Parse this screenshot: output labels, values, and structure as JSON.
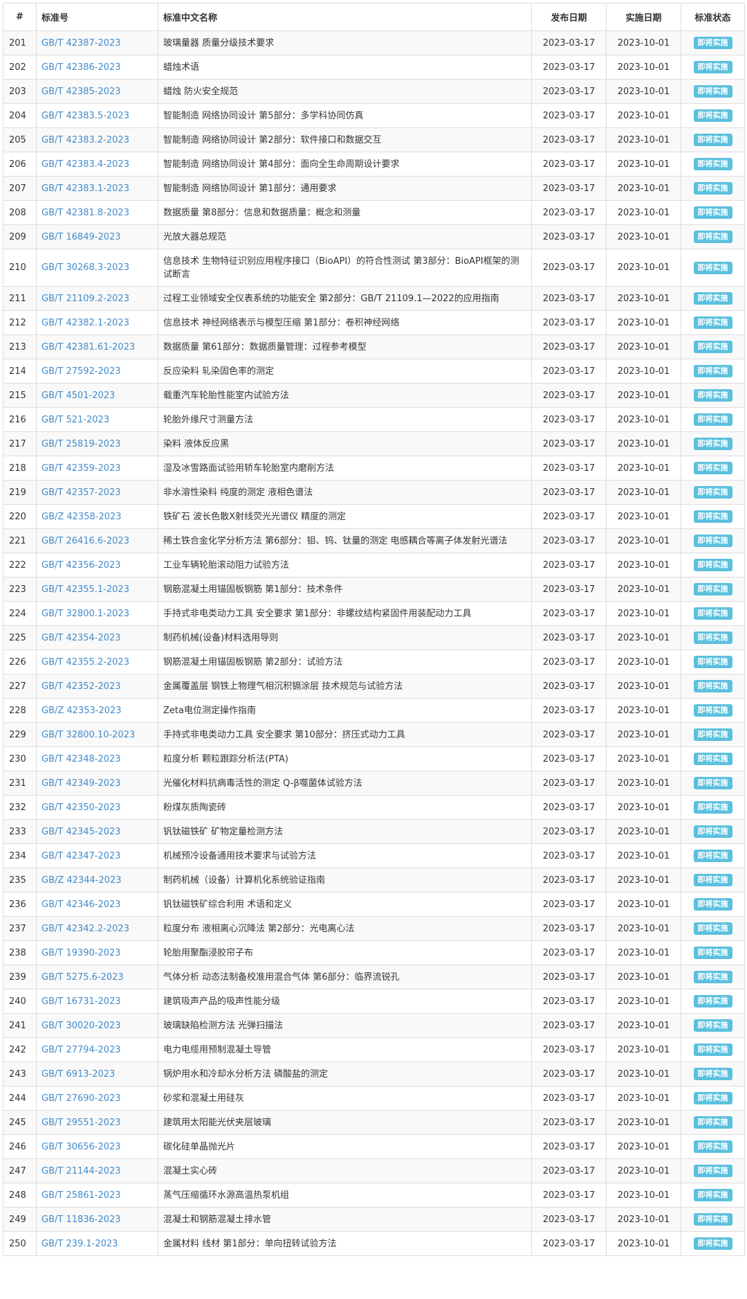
{
  "colors": {
    "link": "#428bca",
    "badge_bg": "#5bc0de",
    "stripe": "#f9f9f9",
    "border": "#dddddd"
  },
  "headers": {
    "num": "#",
    "code": "标准号",
    "name": "标准中文名称",
    "publish": "发布日期",
    "implement": "实施日期",
    "status": "标准状态"
  },
  "rows": [
    {
      "num": "201",
      "code": "GB/T 42387-2023",
      "name": "玻璃量器 质量分级技术要求",
      "publish": "2023-03-17",
      "implement": "2023-10-01",
      "status": "即将实施"
    },
    {
      "num": "202",
      "code": "GB/T 42386-2023",
      "name": "蜡烛术语",
      "publish": "2023-03-17",
      "implement": "2023-10-01",
      "status": "即将实施"
    },
    {
      "num": "203",
      "code": "GB/T 42385-2023",
      "name": "蜡烛 防火安全规范",
      "publish": "2023-03-17",
      "implement": "2023-10-01",
      "status": "即将实施"
    },
    {
      "num": "204",
      "code": "GB/T 42383.5-2023",
      "name": "智能制造 网络协同设计 第5部分：多学科协同仿真",
      "publish": "2023-03-17",
      "implement": "2023-10-01",
      "status": "即将实施"
    },
    {
      "num": "205",
      "code": "GB/T 42383.2-2023",
      "name": "智能制造 网络协同设计 第2部分：软件接口和数据交互",
      "publish": "2023-03-17",
      "implement": "2023-10-01",
      "status": "即将实施"
    },
    {
      "num": "206",
      "code": "GB/T 42383.4-2023",
      "name": "智能制造 网络协同设计 第4部分：面向全生命周期设计要求",
      "publish": "2023-03-17",
      "implement": "2023-10-01",
      "status": "即将实施"
    },
    {
      "num": "207",
      "code": "GB/T 42383.1-2023",
      "name": "智能制造 网络协同设计 第1部分：通用要求",
      "publish": "2023-03-17",
      "implement": "2023-10-01",
      "status": "即将实施"
    },
    {
      "num": "208",
      "code": "GB/T 42381.8-2023",
      "name": "数据质量 第8部分：信息和数据质量：概念和测量",
      "publish": "2023-03-17",
      "implement": "2023-10-01",
      "status": "即将实施"
    },
    {
      "num": "209",
      "code": "GB/T 16849-2023",
      "name": "光放大器总规范",
      "publish": "2023-03-17",
      "implement": "2023-10-01",
      "status": "即将实施"
    },
    {
      "num": "210",
      "code": "GB/T 30268.3-2023",
      "name": "信息技术 生物特征识别应用程序接口（BioAPI）的符合性测试 第3部分：BioAPI框架的测试断言",
      "publish": "2023-03-17",
      "implement": "2023-10-01",
      "status": "即将实施",
      "tall": true
    },
    {
      "num": "211",
      "code": "GB/T 21109.2-2023",
      "name": "过程工业领域安全仪表系统的功能安全 第2部分：GB/T 21109.1—2022的应用指南",
      "publish": "2023-03-17",
      "implement": "2023-10-01",
      "status": "即将实施"
    },
    {
      "num": "212",
      "code": "GB/T 42382.1-2023",
      "name": "信息技术 神经网络表示与模型压缩 第1部分：卷积神经网络",
      "publish": "2023-03-17",
      "implement": "2023-10-01",
      "status": "即将实施"
    },
    {
      "num": "213",
      "code": "GB/T 42381.61-2023",
      "name": "数据质量 第61部分：数据质量管理：过程参考模型",
      "publish": "2023-03-17",
      "implement": "2023-10-01",
      "status": "即将实施"
    },
    {
      "num": "214",
      "code": "GB/T 27592-2023",
      "name": "反应染料 轧染固色率的测定",
      "publish": "2023-03-17",
      "implement": "2023-10-01",
      "status": "即将实施"
    },
    {
      "num": "215",
      "code": "GB/T 4501-2023",
      "name": "载重汽车轮胎性能室内试验方法",
      "publish": "2023-03-17",
      "implement": "2023-10-01",
      "status": "即将实施"
    },
    {
      "num": "216",
      "code": "GB/T 521-2023",
      "name": "轮胎外缘尺寸测量方法",
      "publish": "2023-03-17",
      "implement": "2023-10-01",
      "status": "即将实施"
    },
    {
      "num": "217",
      "code": "GB/T 25819-2023",
      "name": "染料 液体反应黑",
      "publish": "2023-03-17",
      "implement": "2023-10-01",
      "status": "即将实施"
    },
    {
      "num": "218",
      "code": "GB/T 42359-2023",
      "name": "湿及冰雪路面试验用轿车轮胎室内磨削方法",
      "publish": "2023-03-17",
      "implement": "2023-10-01",
      "status": "即将实施"
    },
    {
      "num": "219",
      "code": "GB/T 42357-2023",
      "name": "非水溶性染料 纯度的测定 液相色谱法",
      "publish": "2023-03-17",
      "implement": "2023-10-01",
      "status": "即将实施"
    },
    {
      "num": "220",
      "code": "GB/Z 42358-2023",
      "name": "铁矿石 波长色散X射线荧光光谱仪 精度的测定",
      "publish": "2023-03-17",
      "implement": "2023-10-01",
      "status": "即将实施"
    },
    {
      "num": "221",
      "code": "GB/T 26416.6-2023",
      "name": "稀土铁合金化学分析方法 第6部分：钼、钨、钛量的测定 电感耦合等离子体发射光谱法",
      "publish": "2023-03-17",
      "implement": "2023-10-01",
      "status": "即将实施"
    },
    {
      "num": "222",
      "code": "GB/T 42356-2023",
      "name": "工业车辆轮胎滚动阻力试验方法",
      "publish": "2023-03-17",
      "implement": "2023-10-01",
      "status": "即将实施"
    },
    {
      "num": "223",
      "code": "GB/T 42355.1-2023",
      "name": "钢筋混凝土用锚固板钢筋 第1部分：技术条件",
      "publish": "2023-03-17",
      "implement": "2023-10-01",
      "status": "即将实施"
    },
    {
      "num": "224",
      "code": "GB/T 32800.1-2023",
      "name": "手持式非电类动力工具 安全要求 第1部分：非螺纹结构紧固件用装配动力工具",
      "publish": "2023-03-17",
      "implement": "2023-10-01",
      "status": "即将实施"
    },
    {
      "num": "225",
      "code": "GB/T 42354-2023",
      "name": "制药机械(设备)材料选用导则",
      "publish": "2023-03-17",
      "implement": "2023-10-01",
      "status": "即将实施"
    },
    {
      "num": "226",
      "code": "GB/T 42355.2-2023",
      "name": "钢筋混凝土用锚固板钢筋 第2部分：试验方法",
      "publish": "2023-03-17",
      "implement": "2023-10-01",
      "status": "即将实施"
    },
    {
      "num": "227",
      "code": "GB/T 42352-2023",
      "name": "金属覆盖层 钢铁上物理气相沉积镉涂层 技术规范与试验方法",
      "publish": "2023-03-17",
      "implement": "2023-10-01",
      "status": "即将实施"
    },
    {
      "num": "228",
      "code": "GB/Z 42353-2023",
      "name": "Zeta电位测定操作指南",
      "publish": "2023-03-17",
      "implement": "2023-10-01",
      "status": "即将实施"
    },
    {
      "num": "229",
      "code": "GB/T 32800.10-2023",
      "name": "手持式非电类动力工具 安全要求 第10部分：挤压式动力工具",
      "publish": "2023-03-17",
      "implement": "2023-10-01",
      "status": "即将实施"
    },
    {
      "num": "230",
      "code": "GB/T 42348-2023",
      "name": "粒度分析 颗粒跟踪分析法(PTA)",
      "publish": "2023-03-17",
      "implement": "2023-10-01",
      "status": "即将实施"
    },
    {
      "num": "231",
      "code": "GB/T 42349-2023",
      "name": "光催化材料抗病毒活性的测定 Q-β噬菌体试验方法",
      "publish": "2023-03-17",
      "implement": "2023-10-01",
      "status": "即将实施"
    },
    {
      "num": "232",
      "code": "GB/T 42350-2023",
      "name": "粉煤灰质陶瓷砖",
      "publish": "2023-03-17",
      "implement": "2023-10-01",
      "status": "即将实施"
    },
    {
      "num": "233",
      "code": "GB/T 42345-2023",
      "name": "钒钛磁铁矿 矿物定量检测方法",
      "publish": "2023-03-17",
      "implement": "2023-10-01",
      "status": "即将实施"
    },
    {
      "num": "234",
      "code": "GB/T 42347-2023",
      "name": "机械预冷设备通用技术要求与试验方法",
      "publish": "2023-03-17",
      "implement": "2023-10-01",
      "status": "即将实施"
    },
    {
      "num": "235",
      "code": "GB/Z 42344-2023",
      "name": "制药机械（设备）计算机化系统验证指南",
      "publish": "2023-03-17",
      "implement": "2023-10-01",
      "status": "即将实施"
    },
    {
      "num": "236",
      "code": "GB/T 42346-2023",
      "name": "钒钛磁铁矿综合利用 术语和定义",
      "publish": "2023-03-17",
      "implement": "2023-10-01",
      "status": "即将实施"
    },
    {
      "num": "237",
      "code": "GB/T 42342.2-2023",
      "name": "粒度分布 液相离心沉降法 第2部分：光电离心法",
      "publish": "2023-03-17",
      "implement": "2023-10-01",
      "status": "即将实施"
    },
    {
      "num": "238",
      "code": "GB/T 19390-2023",
      "name": "轮胎用聚酯浸胶帘子布",
      "publish": "2023-03-17",
      "implement": "2023-10-01",
      "status": "即将实施"
    },
    {
      "num": "239",
      "code": "GB/T 5275.6-2023",
      "name": "气体分析 动态法制备校准用混合气体 第6部分：临界流锐孔",
      "publish": "2023-03-17",
      "implement": "2023-10-01",
      "status": "即将实施"
    },
    {
      "num": "240",
      "code": "GB/T 16731-2023",
      "name": "建筑吸声产品的吸声性能分级",
      "publish": "2023-03-17",
      "implement": "2023-10-01",
      "status": "即将实施"
    },
    {
      "num": "241",
      "code": "GB/T 30020-2023",
      "name": "玻璃缺陷检测方法 光弹扫描法",
      "publish": "2023-03-17",
      "implement": "2023-10-01",
      "status": "即将实施"
    },
    {
      "num": "242",
      "code": "GB/T 27794-2023",
      "name": "电力电缆用预制混凝土导管",
      "publish": "2023-03-17",
      "implement": "2023-10-01",
      "status": "即将实施"
    },
    {
      "num": "243",
      "code": "GB/T 6913-2023",
      "name": "锅炉用水和冷却水分析方法 磷酸盐的测定",
      "publish": "2023-03-17",
      "implement": "2023-10-01",
      "status": "即将实施"
    },
    {
      "num": "244",
      "code": "GB/T 27690-2023",
      "name": "砂浆和混凝土用硅灰",
      "publish": "2023-03-17",
      "implement": "2023-10-01",
      "status": "即将实施"
    },
    {
      "num": "245",
      "code": "GB/T 29551-2023",
      "name": "建筑用太阳能光伏夹层玻璃",
      "publish": "2023-03-17",
      "implement": "2023-10-01",
      "status": "即将实施"
    },
    {
      "num": "246",
      "code": "GB/T 30656-2023",
      "name": "碳化硅单晶抛光片",
      "publish": "2023-03-17",
      "implement": "2023-10-01",
      "status": "即将实施"
    },
    {
      "num": "247",
      "code": "GB/T 21144-2023",
      "name": "混凝土实心砖",
      "publish": "2023-03-17",
      "implement": "2023-10-01",
      "status": "即将实施"
    },
    {
      "num": "248",
      "code": "GB/T 25861-2023",
      "name": "蒸气压缩循环水源高温热泵机组",
      "publish": "2023-03-17",
      "implement": "2023-10-01",
      "status": "即将实施"
    },
    {
      "num": "249",
      "code": "GB/T 11836-2023",
      "name": "混凝土和钢筋混凝土排水管",
      "publish": "2023-03-17",
      "implement": "2023-10-01",
      "status": "即将实施"
    },
    {
      "num": "250",
      "code": "GB/T 239.1-2023",
      "name": "金属材料 线材 第1部分：单向扭转试验方法",
      "publish": "2023-03-17",
      "implement": "2023-10-01",
      "status": "即将实施"
    }
  ]
}
